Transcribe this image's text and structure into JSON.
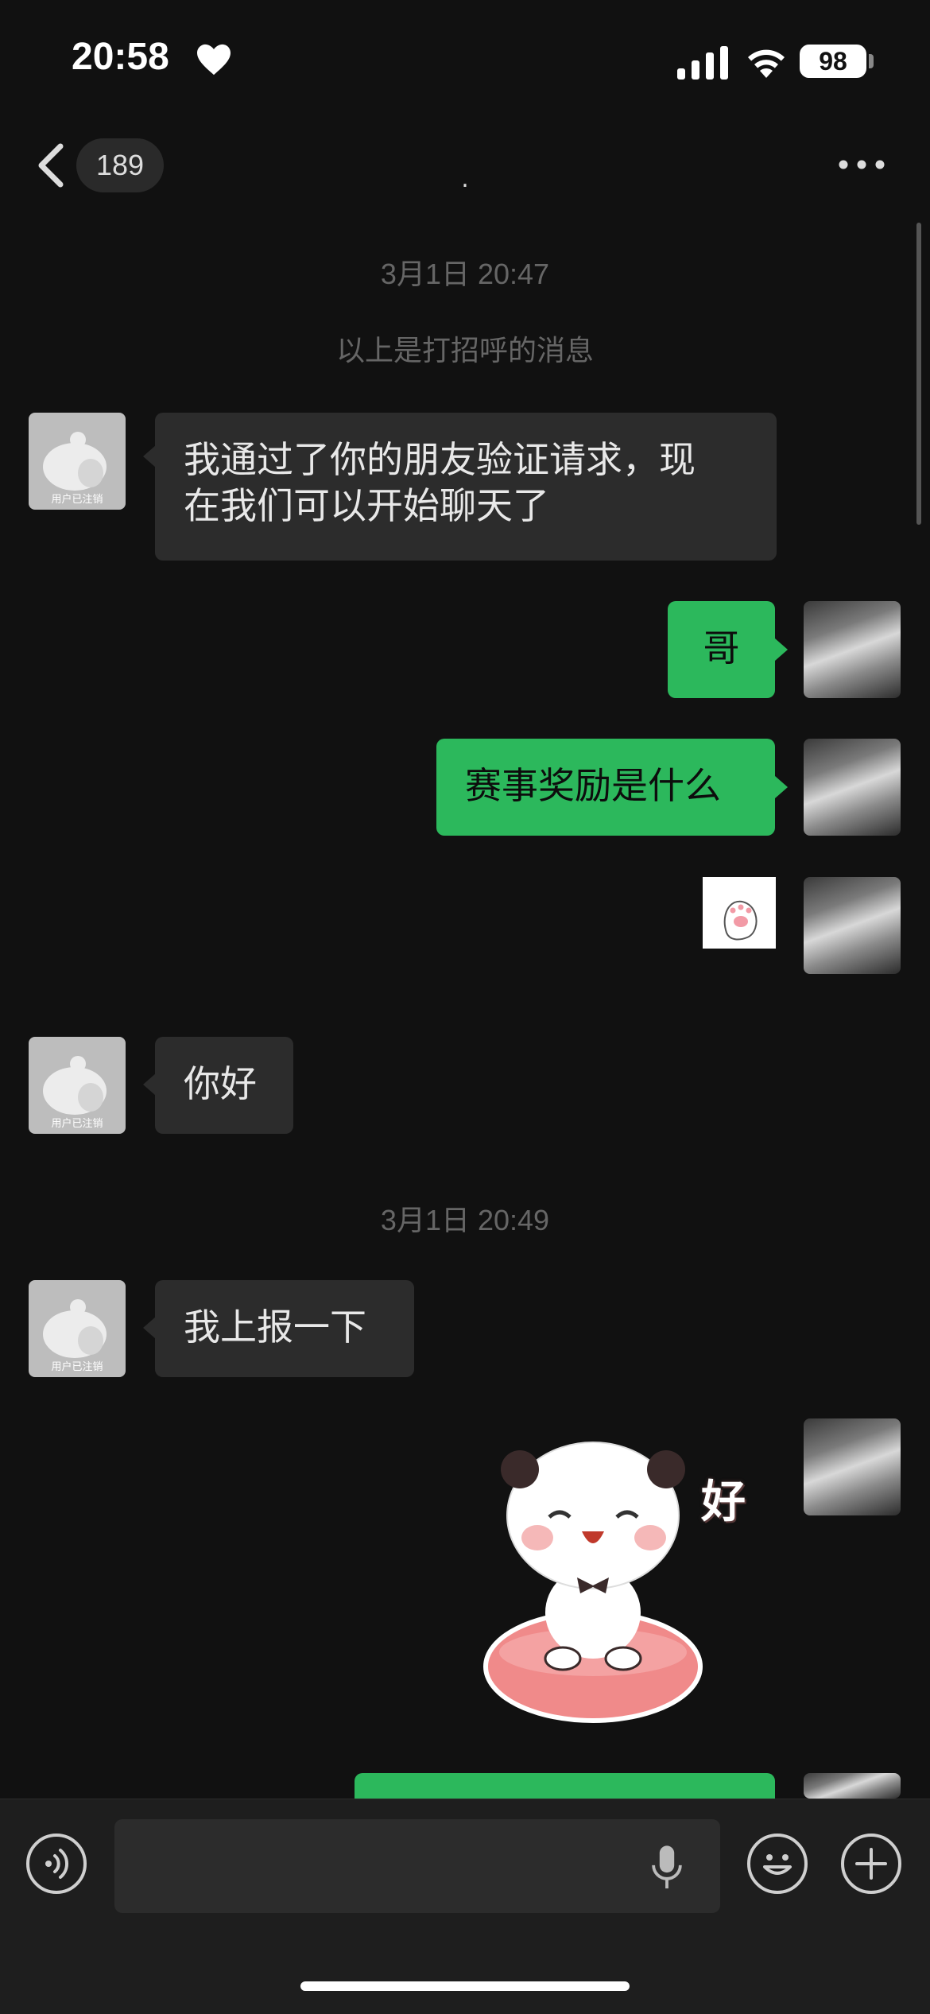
{
  "status_bar": {
    "time": "20:58",
    "battery": "98"
  },
  "nav": {
    "unread_count": "189",
    "title": "."
  },
  "messages": [
    {
      "type": "timestamp",
      "text": "3月1日 20:47"
    },
    {
      "type": "system",
      "text": "以上是打招呼的消息"
    },
    {
      "type": "incoming",
      "avatar_label": "用户已注销",
      "lines": [
        "我通过了你的朋友验证请求，现",
        "在我们可以开始聊天了"
      ]
    },
    {
      "type": "outgoing",
      "text": "哥"
    },
    {
      "type": "outgoing",
      "text": "赛事奖励是什么"
    },
    {
      "type": "outgoing-sticker",
      "sticker": "paw-sticker"
    },
    {
      "type": "incoming",
      "avatar_label": "用户已注销",
      "text": "你好"
    },
    {
      "type": "timestamp",
      "text": "3月1日 20:49"
    },
    {
      "type": "incoming",
      "avatar_label": "用户已注销",
      "text": "我上报一下"
    },
    {
      "type": "outgoing-sticker",
      "sticker": "panda-sticker",
      "caption": "好"
    }
  ],
  "input_bar": {
    "placeholder": ""
  },
  "colors": {
    "background": "#111111",
    "outgoing_bubble": "#2cb85c",
    "incoming_bubble": "#2c2c2c"
  }
}
